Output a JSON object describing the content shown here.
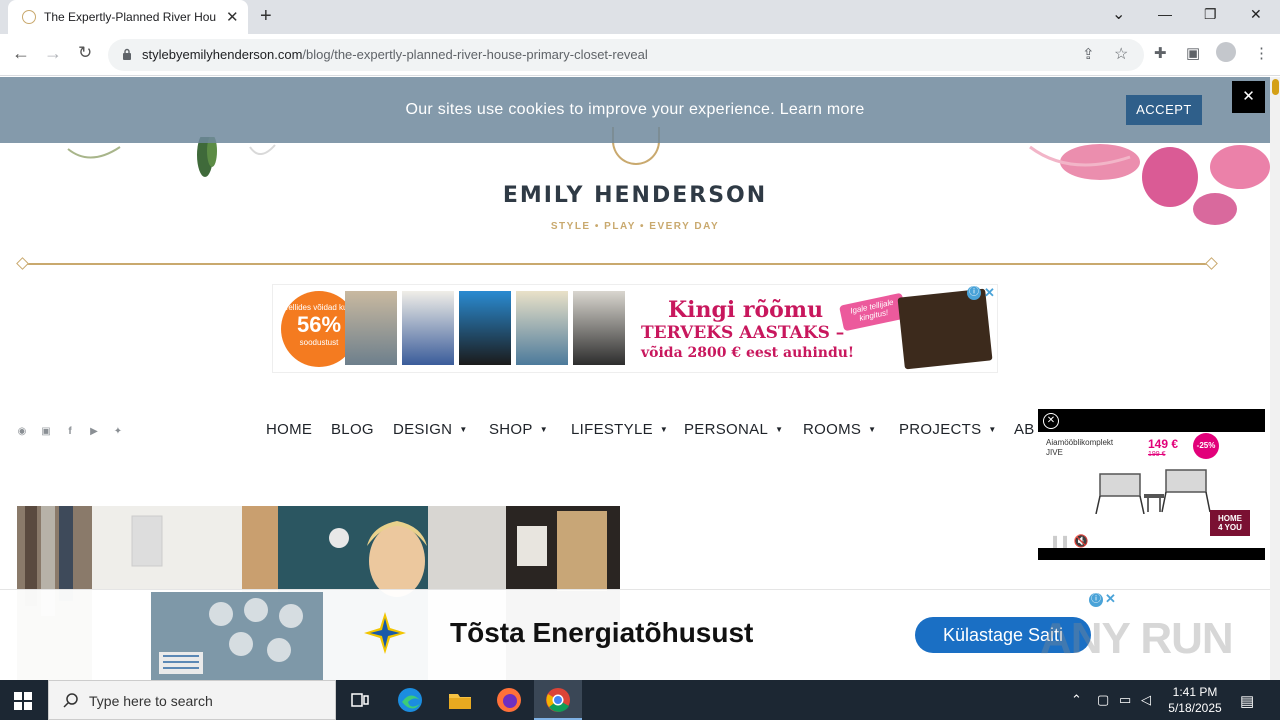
{
  "browser": {
    "tab_title": "The Expertly-Planned River Hou",
    "tab_close": "✕",
    "new_tab": "+",
    "url_domain": "stylebyemilyhenderson.com",
    "url_path": "/blog/the-expertly-planned-river-house-primary-closet-reveal",
    "controls": {
      "minimize": "—",
      "restore": "❐",
      "close": "✕",
      "tab_search": "⌄"
    }
  },
  "header": {
    "brand": "EMILY HENDERSON",
    "tagline": "STYLE  •  PLAY  •  EVERY DAY"
  },
  "cookie_bar": {
    "message": "Our sites use cookies to improve your experience. Learn more",
    "accept_label": "ACCEPT",
    "close_label": "✕"
  },
  "ad_top": {
    "badge_small": "Tellides võidad kuni",
    "badge_percent": "56%",
    "badge_bottom": "soodustust",
    "title": "Kingi rõõmu",
    "subtitle": "TERVEKS AASTAKS –",
    "prize": "võida 2800 € eest auhindu!",
    "pill": "Igale tellijale kingitus!",
    "choices_icon": "ⓘ",
    "close_icon": "✕"
  },
  "nav": {
    "items": [
      {
        "label": "HOME",
        "dropdown": false
      },
      {
        "label": "BLOG",
        "dropdown": false
      },
      {
        "label": "DESIGN",
        "dropdown": true
      },
      {
        "label": "SHOP",
        "dropdown": true
      },
      {
        "label": "LIFESTYLE",
        "dropdown": true
      },
      {
        "label": "PERSONAL",
        "dropdown": true
      },
      {
        "label": "ROOMS",
        "dropdown": true
      },
      {
        "label": "PROJECTS",
        "dropdown": true
      },
      {
        "label": "AB",
        "dropdown": false
      }
    ],
    "caret": "▼"
  },
  "social": [
    "pinterest-icon",
    "instagram-icon",
    "facebook-icon",
    "youtube-icon",
    "twitter-icon"
  ],
  "video_ad": {
    "close": "✕",
    "text_line1": "Aiamööblikomplekt",
    "text_line2": "JIVE",
    "price": "149 €",
    "old_price": "199 €",
    "discount": "-25%",
    "logo_line1": "HOME",
    "logo_line2": "4 YOU",
    "controls": "❚❚   🔇"
  },
  "ad_bottom": {
    "headline": "Tõsta Energiatõhusust",
    "cta": "Külastage Saiti",
    "choices_icon": "ⓘ",
    "close_icon": "✕"
  },
  "watermark": "ANY RUN",
  "taskbar": {
    "search_placeholder": "Type here to search",
    "time": "1:41 PM",
    "date": "5/18/2025"
  },
  "colors": {
    "gold": "#c9a96e",
    "cookie_bar": "#6e889c",
    "accept_button": "#2f5f8a",
    "ad_pink": "#c8175d",
    "cta_blue": "#1a6fc4",
    "taskbar": "#1c2733"
  }
}
